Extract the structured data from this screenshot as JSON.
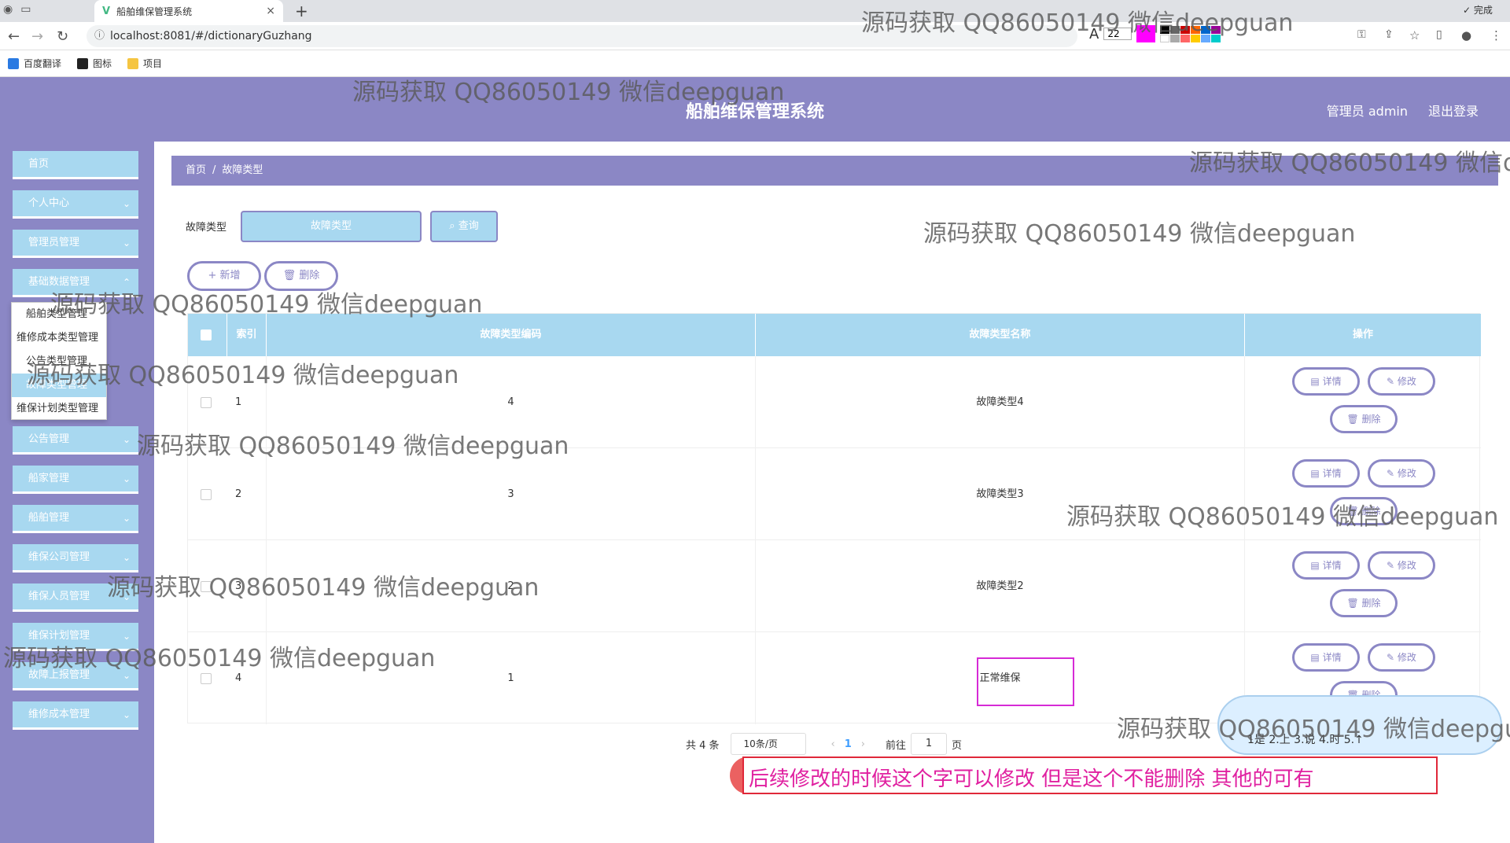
{
  "browser": {
    "tab_title": "船舶维保管理系统",
    "url": "localhost:8081/#/dictionaryGuzhang",
    "font_size_value": "22",
    "done_label": "完成",
    "bookmarks": [
      "百度翻译",
      "图标",
      "项目"
    ]
  },
  "header": {
    "title": "船舶维保管理系统",
    "user": "管理员 admin",
    "logout": "退出登录"
  },
  "sidebar": {
    "items": [
      {
        "label": "首页"
      },
      {
        "label": "个人中心"
      },
      {
        "label": "管理员管理"
      },
      {
        "label": "基础数据管理"
      },
      {
        "label": "公告管理"
      },
      {
        "label": "船家管理"
      },
      {
        "label": "船舶管理"
      },
      {
        "label": "维保公司管理"
      },
      {
        "label": "维保人员管理"
      },
      {
        "label": "维保计划管理"
      },
      {
        "label": "故障上报管理"
      },
      {
        "label": "维修成本管理"
      }
    ],
    "submenu": [
      "船舶类型管理",
      "维修成本类型管理",
      "公告类型管理",
      "故障类型管理",
      "维保计划类型管理"
    ]
  },
  "breadcrumb": {
    "home": "首页",
    "current": "故障类型"
  },
  "search": {
    "label": "故障类型",
    "placeholder": "故障类型",
    "button": "查询"
  },
  "toolbar": {
    "add": "新增",
    "delete": "删除"
  },
  "table": {
    "headers": {
      "index": "索引",
      "code": "故障类型编码",
      "name": "故障类型名称",
      "action": "操作"
    },
    "rows": [
      {
        "index": "1",
        "code": "4",
        "name": "故障类型4"
      },
      {
        "index": "2",
        "code": "3",
        "name": "故障类型3"
      },
      {
        "index": "3",
        "code": "2",
        "name": "故障类型2"
      },
      {
        "index": "4",
        "code": "1",
        "name": "正常维保"
      }
    ],
    "detail_label": "详情",
    "edit_label": "修改",
    "delete_label": "删除"
  },
  "pagination": {
    "total": "共 4 条",
    "page_size": "10条/页",
    "current_page": "1",
    "goto_label": "前往",
    "goto_value": "1",
    "page_unit": "页"
  },
  "ime": {
    "text": "后续修改的时候这个字可以修改  但是这个不能删除  其他的可有",
    "candidates": "1是  2.上  3.说  4.时  5.↑"
  },
  "watermark": "源码获取 QQ86050149 微信deepguan",
  "colors": {
    "purple": "#8b87c5",
    "light_blue": "#a8d8f0",
    "magenta": "#d62ad6",
    "red": "#e0283a"
  }
}
